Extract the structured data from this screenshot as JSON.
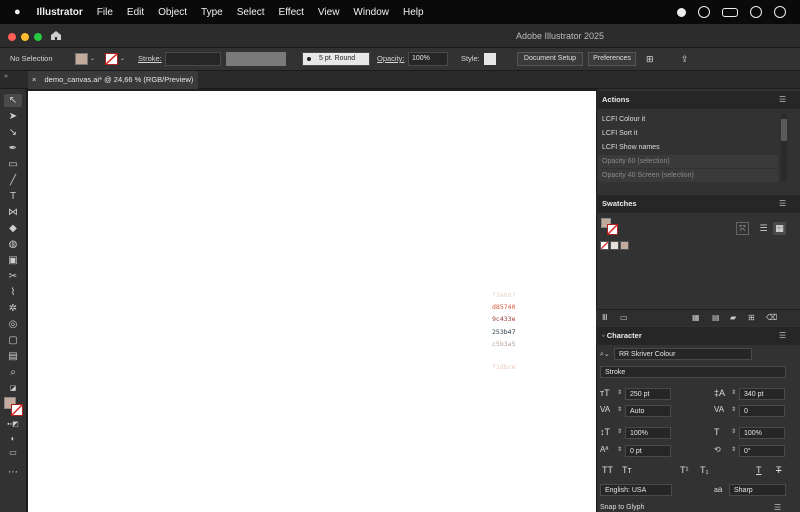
{
  "menubar": {
    "app": "Illustrator",
    "items": [
      "File",
      "Edit",
      "Object",
      "Type",
      "Select",
      "Effect",
      "View",
      "Window",
      "Help"
    ]
  },
  "window": {
    "title": "Adobe Illustrator 2025"
  },
  "control": {
    "selection": "No Selection",
    "stroke_label": "Stroke:",
    "brush": "5 pt. Round",
    "opacity_label": "Opacity:",
    "opacity_value": "100%",
    "style_label": "Style:",
    "doc_setup": "Document Setup",
    "preferences": "Preferences"
  },
  "doc_tab": {
    "close": "×",
    "title": "demo_canvas.ai* @ 24,66 % (RGB/Preview)"
  },
  "canvas": {
    "swatches": [
      {
        "hex": "f2e6d7",
        "color": "#e8d6cc"
      },
      {
        "hex": "d85740",
        "color": "#d85740"
      },
      {
        "hex": "9c433e",
        "color": "#9c433e"
      },
      {
        "hex": "253b47",
        "color": "#253b47"
      },
      {
        "hex": "c5b3a5",
        "color": "#b8a49a"
      },
      {
        "hex": "f2dbce",
        "color": "#e9c9bb"
      }
    ]
  },
  "actions": {
    "title": "Actions",
    "items": [
      "LCFI Colour it",
      "LCFI Sort it",
      "LCFI Show names",
      "Opacity 60 (selection)",
      "Opacity 40 Screen (selection)"
    ]
  },
  "swatches": {
    "title": "Swatches"
  },
  "character": {
    "title": "Character",
    "font_family": "RR Skriver Colour",
    "font_style": "Stroke",
    "size": "250 pt",
    "leading": "340 pt",
    "kerning": "Auto",
    "tracking": "0",
    "vscale": "100%",
    "hscale": "100%",
    "baseline": "0 pt",
    "rotation": "0°",
    "language": "English: USA",
    "aa_label": "a",
    "antialias": "Sharp",
    "snap": "Snap to Glyph"
  },
  "colors": {
    "canvas": "#ffffff",
    "panel": "#323232",
    "panel_header": "#262626"
  }
}
